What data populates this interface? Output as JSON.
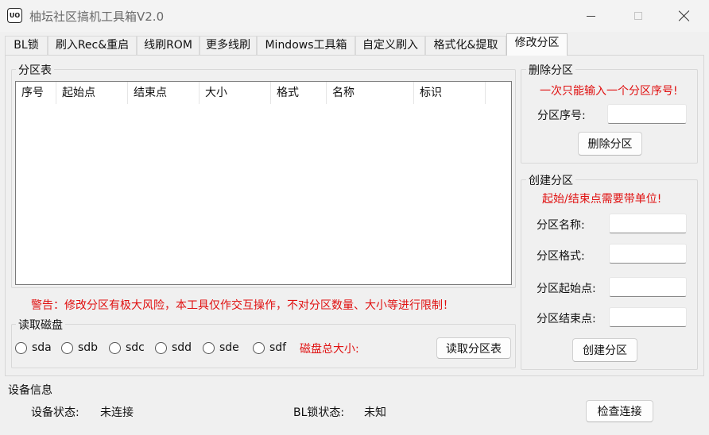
{
  "window": {
    "icon_text": "UO",
    "title": "柚坛社区搞机工具箱V2.0"
  },
  "tabs": [
    {
      "label": "BL锁",
      "active": false
    },
    {
      "label": "刷入Rec&重启",
      "active": false
    },
    {
      "label": "线刷ROM",
      "active": false
    },
    {
      "label": "更多线刷",
      "active": false
    },
    {
      "label": "Mindows工具箱",
      "active": false
    },
    {
      "label": "自定义刷入",
      "active": false
    },
    {
      "label": "格式化&提取",
      "active": false
    },
    {
      "label": "修改分区",
      "active": true
    }
  ],
  "partition_table": {
    "group_title": "分区表",
    "columns": [
      "序号",
      "起始点",
      "结束点",
      "大小",
      "格式",
      "名称",
      "标识"
    ],
    "rows": []
  },
  "warning": "警告：修改分区有极大风险，本工具仅作交互操作，不对分区数量、大小等进行限制！",
  "read_disk": {
    "group_title": "读取磁盘",
    "disks": [
      "sda",
      "sdb",
      "sdc",
      "sdd",
      "sde",
      "sdf"
    ],
    "total_size_label": "磁盘总大小:",
    "read_button": "读取分区表"
  },
  "delete_partition": {
    "group_title": "删除分区",
    "hint": "一次只能输入一个分区序号!",
    "number_label": "分区序号:",
    "number_value": "",
    "button": "删除分区"
  },
  "create_partition": {
    "group_title": "创建分区",
    "hint": "起始/结束点需要带单位!",
    "name_label": "分区名称:",
    "format_label": "分区格式:",
    "start_label": "分区起始点:",
    "end_label": "分区结束点:",
    "name_value": "",
    "format_value": "",
    "start_value": "",
    "end_value": "",
    "button": "创建分区"
  },
  "device_info": {
    "group_title": "设备信息",
    "device_status_label": "设备状态:",
    "device_status_value": "未连接",
    "bl_status_label": "BL锁状态:",
    "bl_status_value": "未知",
    "check_button": "检查连接"
  },
  "colors": {
    "warning_red": "#e01010",
    "background": "#f0f0f0"
  }
}
